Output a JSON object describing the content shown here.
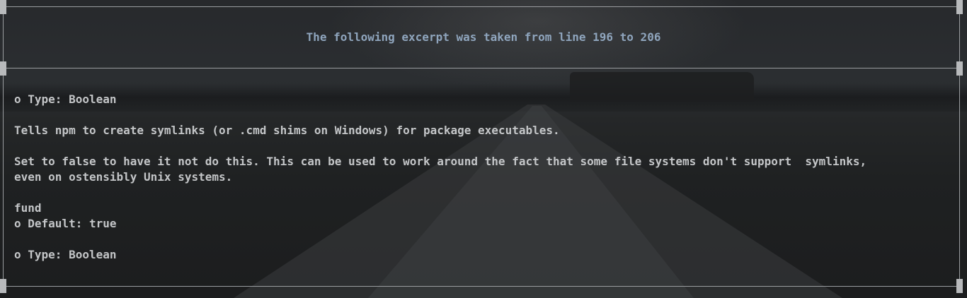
{
  "header": {
    "text": "The following excerpt was taken from line 196 to 206"
  },
  "excerpt": {
    "lines": [
      "o Type: Boolean",
      "",
      "Tells npm to create symlinks (or .cmd shims on Windows) for package executables.",
      "",
      "Set to false to have it not do this. This can be used to work around the fact that some file systems don't support  symlinks,",
      "even on ostensibly Unix systems.",
      "",
      "fund",
      "o Default: true",
      "",
      "o Type: Boolean"
    ]
  },
  "colors": {
    "header_text": "#8fa5bd",
    "body_text": "#c4c6c8",
    "frame": "#9a9da0"
  }
}
